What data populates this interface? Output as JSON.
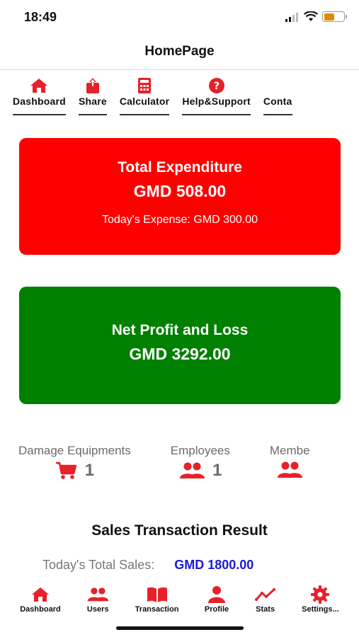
{
  "status_bar": {
    "time": "18:49",
    "battery_level": 0.55
  },
  "header": {
    "title": "HomePage"
  },
  "top_menu": [
    {
      "label": "Dashboard",
      "icon": "home-icon"
    },
    {
      "label": "Share",
      "icon": "share-icon"
    },
    {
      "label": "Calculator",
      "icon": "calculator-icon"
    },
    {
      "label": "Help&Support",
      "icon": "help-icon"
    },
    {
      "label": "Conta",
      "icon": "contact-icon"
    }
  ],
  "expenditure_card": {
    "title": "Total Expenditure",
    "amount": "GMD 508.00",
    "today_expense": "Today's  Expense: GMD 300.00",
    "color": "#ff0000"
  },
  "profit_card": {
    "title": "Net Profit and Loss",
    "amount": "GMD 3292.00",
    "color": "#008000"
  },
  "stats": [
    {
      "label": "Damage Equipments",
      "icon": "cart-icon",
      "count": "1"
    },
    {
      "label": "Employees",
      "icon": "users-icon",
      "count": "1"
    },
    {
      "label": "Membe",
      "icon": "users-icon",
      "count": ""
    }
  ],
  "sales": {
    "title": "Sales Transaction Result",
    "today_label": "Today's Total Sales:",
    "today_value": "GMD 1800.00"
  },
  "tab_bar": [
    {
      "label": "Dashboard",
      "icon": "home-icon"
    },
    {
      "label": "Users",
      "icon": "users-icon"
    },
    {
      "label": "Transaction",
      "icon": "book-icon"
    },
    {
      "label": "Profile",
      "icon": "person-icon"
    },
    {
      "label": "Stats",
      "icon": "chart-line-icon"
    },
    {
      "label": "Settings...",
      "icon": "gear-icon"
    }
  ],
  "accent_color": "#e8202a"
}
